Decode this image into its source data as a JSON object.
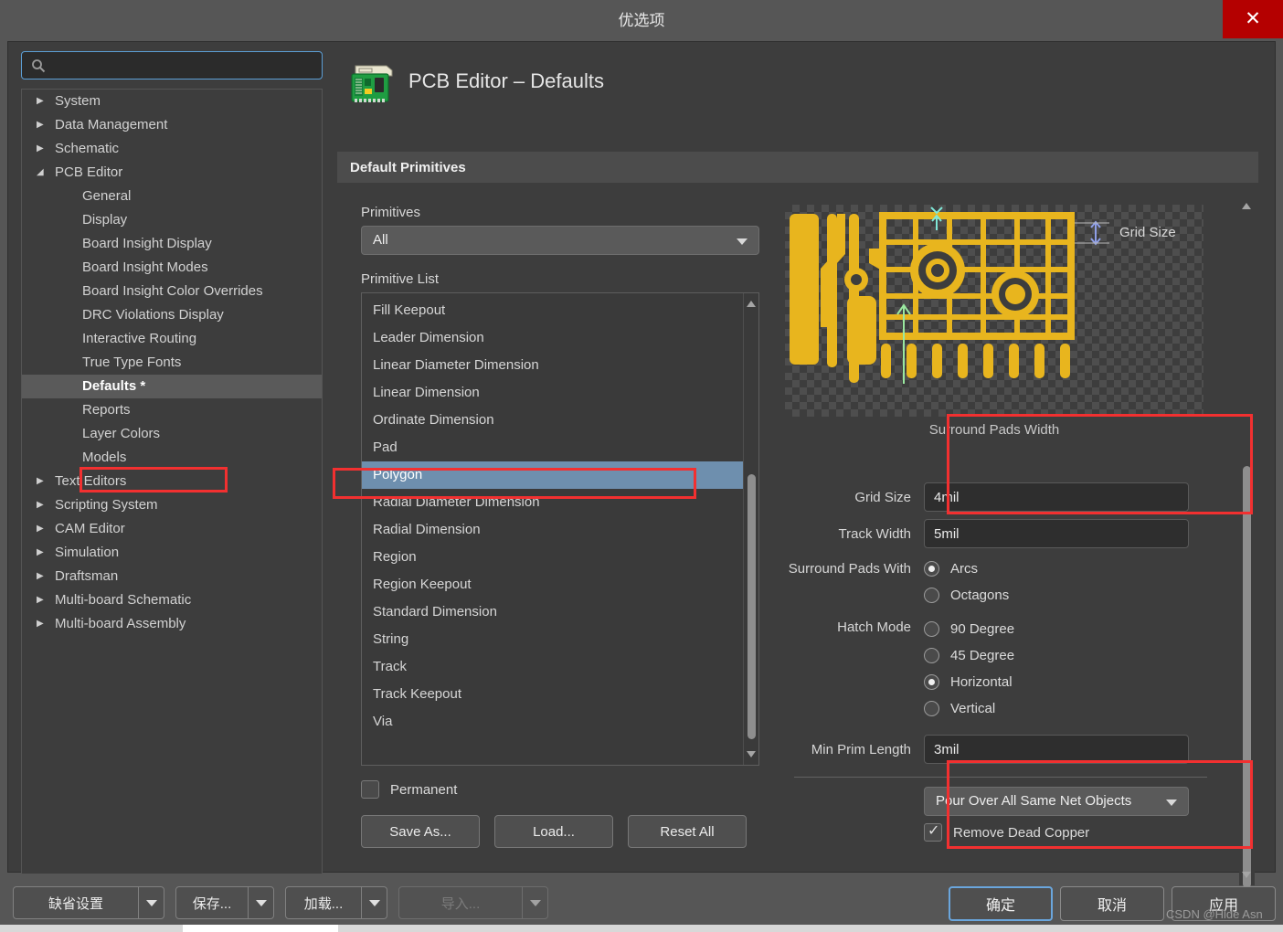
{
  "window": {
    "title": "优选项",
    "close_label": "✕",
    "close_icon": "close-icon",
    "accent_red": "#b40000",
    "annotation_red": "#f23030",
    "selection_blue": "#6e8fae",
    "focus_blue": "#5c9fd6"
  },
  "search": {
    "value": "",
    "placeholder": "",
    "icon": "search-icon"
  },
  "sidebar": {
    "items": [
      {
        "label": "System",
        "level": 0,
        "arrow": "▶",
        "selected": false
      },
      {
        "label": "Data Management",
        "level": 0,
        "arrow": "▶",
        "selected": false
      },
      {
        "label": "Schematic",
        "level": 0,
        "arrow": "▶",
        "selected": false
      },
      {
        "label": "PCB Editor",
        "level": 0,
        "arrow": "◢",
        "selected": false
      },
      {
        "label": "General",
        "level": 1,
        "arrow": "",
        "selected": false
      },
      {
        "label": "Display",
        "level": 1,
        "arrow": "",
        "selected": false
      },
      {
        "label": "Board Insight Display",
        "level": 1,
        "arrow": "",
        "selected": false
      },
      {
        "label": "Board Insight Modes",
        "level": 1,
        "arrow": "",
        "selected": false
      },
      {
        "label": "Board Insight Color Overrides",
        "level": 1,
        "arrow": "",
        "selected": false
      },
      {
        "label": "DRC Violations Display",
        "level": 1,
        "arrow": "",
        "selected": false
      },
      {
        "label": "Interactive Routing",
        "level": 1,
        "arrow": "",
        "selected": false
      },
      {
        "label": "True Type Fonts",
        "level": 1,
        "arrow": "",
        "selected": false
      },
      {
        "label": "Defaults *",
        "level": 1,
        "arrow": "",
        "selected": true
      },
      {
        "label": "Reports",
        "level": 1,
        "arrow": "",
        "selected": false
      },
      {
        "label": "Layer Colors",
        "level": 1,
        "arrow": "",
        "selected": false
      },
      {
        "label": "Models",
        "level": 1,
        "arrow": "",
        "selected": false
      },
      {
        "label": "Text Editors",
        "level": 0,
        "arrow": "▶",
        "selected": false
      },
      {
        "label": "Scripting System",
        "level": 0,
        "arrow": "▶",
        "selected": false
      },
      {
        "label": "CAM Editor",
        "level": 0,
        "arrow": "▶",
        "selected": false
      },
      {
        "label": "Simulation",
        "level": 0,
        "arrow": "▶",
        "selected": false
      },
      {
        "label": "Draftsman",
        "level": 0,
        "arrow": "▶",
        "selected": false
      },
      {
        "label": "Multi-board Schematic",
        "level": 0,
        "arrow": "▶",
        "selected": false
      },
      {
        "label": "Multi-board Assembly",
        "level": 0,
        "arrow": "▶",
        "selected": false
      }
    ]
  },
  "page": {
    "title": "PCB Editor – Defaults",
    "icon": "pcb-board-icon",
    "section_title": "Default Primitives"
  },
  "primitives": {
    "filter_label": "Primitives",
    "filter_value": "All",
    "list_label": "Primitive List",
    "items": [
      "Fill Keepout",
      "Leader Dimension",
      "Linear Diameter Dimension",
      "Linear Dimension",
      "Ordinate Dimension",
      "Pad",
      "Polygon",
      "Radial Diameter Dimension",
      "Radial Dimension",
      "Region",
      "Region Keepout",
      "Standard Dimension",
      "String",
      "Track",
      "Track Keepout",
      "Via"
    ],
    "selected_item": "Polygon",
    "permanent_label": "Permanent",
    "permanent_checked": false,
    "buttons": {
      "save_as": "Save As...",
      "load": "Load...",
      "reset_all": "Reset All"
    }
  },
  "preview": {
    "caption": "Surround Pads Width",
    "grid_size_label": "Grid Size",
    "copper_color": "#e8b51e",
    "dimension_color": "#8f9fe8"
  },
  "settings": {
    "grid_size": {
      "label": "Grid Size",
      "value": "4mil"
    },
    "track_width": {
      "label": "Track Width",
      "value": "5mil"
    },
    "surround_pads_with": {
      "label": "Surround Pads With",
      "options": [
        {
          "label": "Arcs",
          "checked": true
        },
        {
          "label": "Octagons",
          "checked": false
        }
      ]
    },
    "hatch_mode": {
      "label": "Hatch Mode",
      "options": [
        {
          "label": "90 Degree",
          "checked": false
        },
        {
          "label": "45 Degree",
          "checked": false
        },
        {
          "label": "Horizontal",
          "checked": true
        },
        {
          "label": "Vertical",
          "checked": false
        }
      ]
    },
    "min_prim_length": {
      "label": "Min Prim Length",
      "value": "3mil"
    },
    "pour_mode": {
      "value": "Pour Over All Same Net Objects"
    },
    "remove_dead_copper": {
      "label": "Remove Dead Copper",
      "checked": true
    }
  },
  "footer": {
    "defaults_button": "缺省设置",
    "save_button": "保存...",
    "load_button": "加载...",
    "import_button": "导入...",
    "import_disabled": true,
    "ok_button": "确定",
    "cancel_button": "取消",
    "apply_button": "应用",
    "watermark": "CSDN @Hide Asn"
  }
}
